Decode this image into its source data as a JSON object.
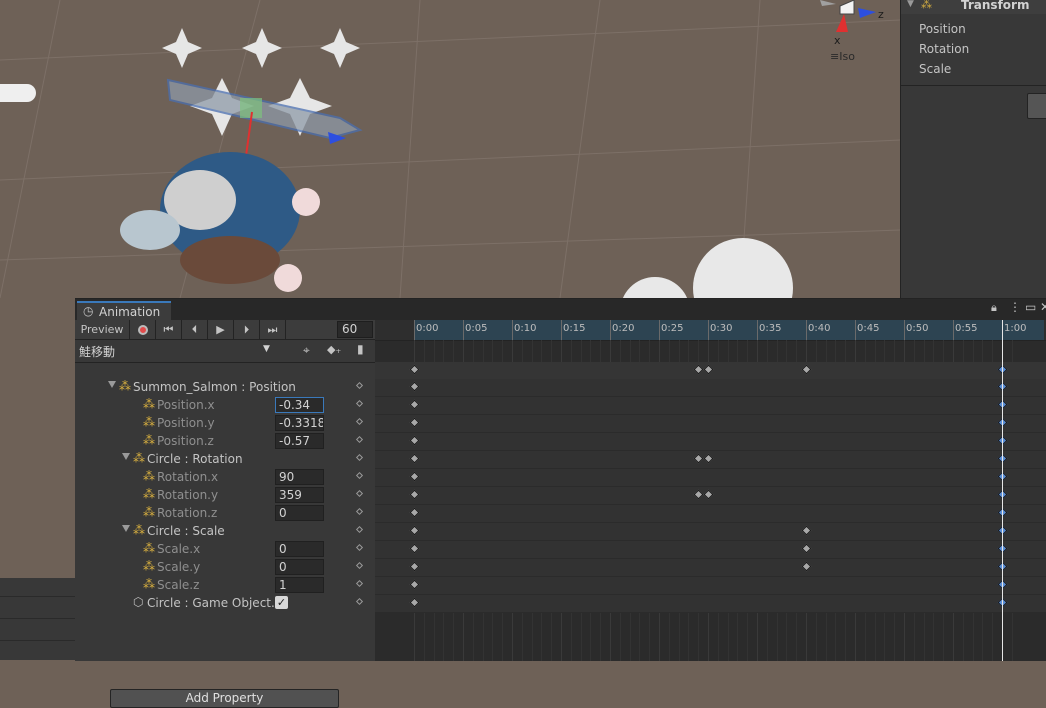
{
  "scene": {
    "gizmo": {
      "x": "x",
      "z": "z",
      "view_mode": "Iso"
    }
  },
  "inspector": {
    "component": "Transform",
    "rows": [
      "Position",
      "Rotation",
      "Scale"
    ]
  },
  "animation": {
    "tab_title": "Animation",
    "toolbar": {
      "preview_label": "Preview",
      "frame": "60"
    },
    "clip_name": "鮭移動",
    "properties": [
      {
        "indent": 0,
        "label": "Summon_Salmon : Position",
        "group": true,
        "value": ""
      },
      {
        "indent": 1,
        "label": "Position.x",
        "group": false,
        "value": "-0.34"
      },
      {
        "indent": 1,
        "label": "Position.y",
        "group": false,
        "value": "-0.3318"
      },
      {
        "indent": 1,
        "label": "Position.z",
        "group": false,
        "value": "-0.57"
      },
      {
        "indent": 0,
        "label": "Circle : Rotation",
        "group": true,
        "value": ""
      },
      {
        "indent": 1,
        "label": "Rotation.x",
        "group": false,
        "value": "90"
      },
      {
        "indent": 1,
        "label": "Rotation.y",
        "group": false,
        "value": "359"
      },
      {
        "indent": 1,
        "label": "Rotation.z",
        "group": false,
        "value": "0"
      },
      {
        "indent": 0,
        "label": "Circle : Scale",
        "group": true,
        "value": ""
      },
      {
        "indent": 1,
        "label": "Scale.x",
        "group": false,
        "value": "0"
      },
      {
        "indent": 1,
        "label": "Scale.y",
        "group": false,
        "value": "0"
      },
      {
        "indent": 1,
        "label": "Scale.z",
        "group": false,
        "value": "1"
      },
      {
        "indent": 0,
        "label": "Circle : Game Object.Is",
        "group": false,
        "value": "✓"
      }
    ],
    "add_property_label": "Add Property",
    "ruler_labels": [
      "0:00",
      "0:05",
      "0:10",
      "0:15",
      "0:20",
      "0:25",
      "0:30",
      "0:35",
      "0:40",
      "0:45",
      "0:50",
      "0:55",
      "1:00"
    ],
    "keyframe_rows": [
      {
        "row": "summary",
        "times": [
          0,
          29,
          30,
          40,
          60
        ]
      },
      {
        "row": "Summon_Salmon : Position",
        "times": [
          0,
          60
        ]
      },
      {
        "row": "Position.x",
        "times": [
          0,
          60
        ]
      },
      {
        "row": "Position.y",
        "times": [
          0,
          60
        ]
      },
      {
        "row": "Position.z",
        "times": [
          0,
          60
        ]
      },
      {
        "row": "Circle : Rotation",
        "times": [
          0,
          29,
          30,
          60
        ]
      },
      {
        "row": "Rotation.x",
        "times": [
          0,
          60
        ]
      },
      {
        "row": "Rotation.y",
        "times": [
          0,
          29,
          30,
          60
        ]
      },
      {
        "row": "Rotation.z",
        "times": [
          0,
          60
        ]
      },
      {
        "row": "Circle : Scale",
        "times": [
          0,
          40,
          60
        ]
      },
      {
        "row": "Scale.x",
        "times": [
          0,
          40,
          60
        ]
      },
      {
        "row": "Scale.y",
        "times": [
          0,
          40,
          60
        ]
      },
      {
        "row": "Scale.z",
        "times": [
          0,
          60
        ]
      },
      {
        "row": "Circle : Game Object.Is",
        "times": [
          0,
          60
        ]
      }
    ],
    "playhead_frame": 60
  }
}
